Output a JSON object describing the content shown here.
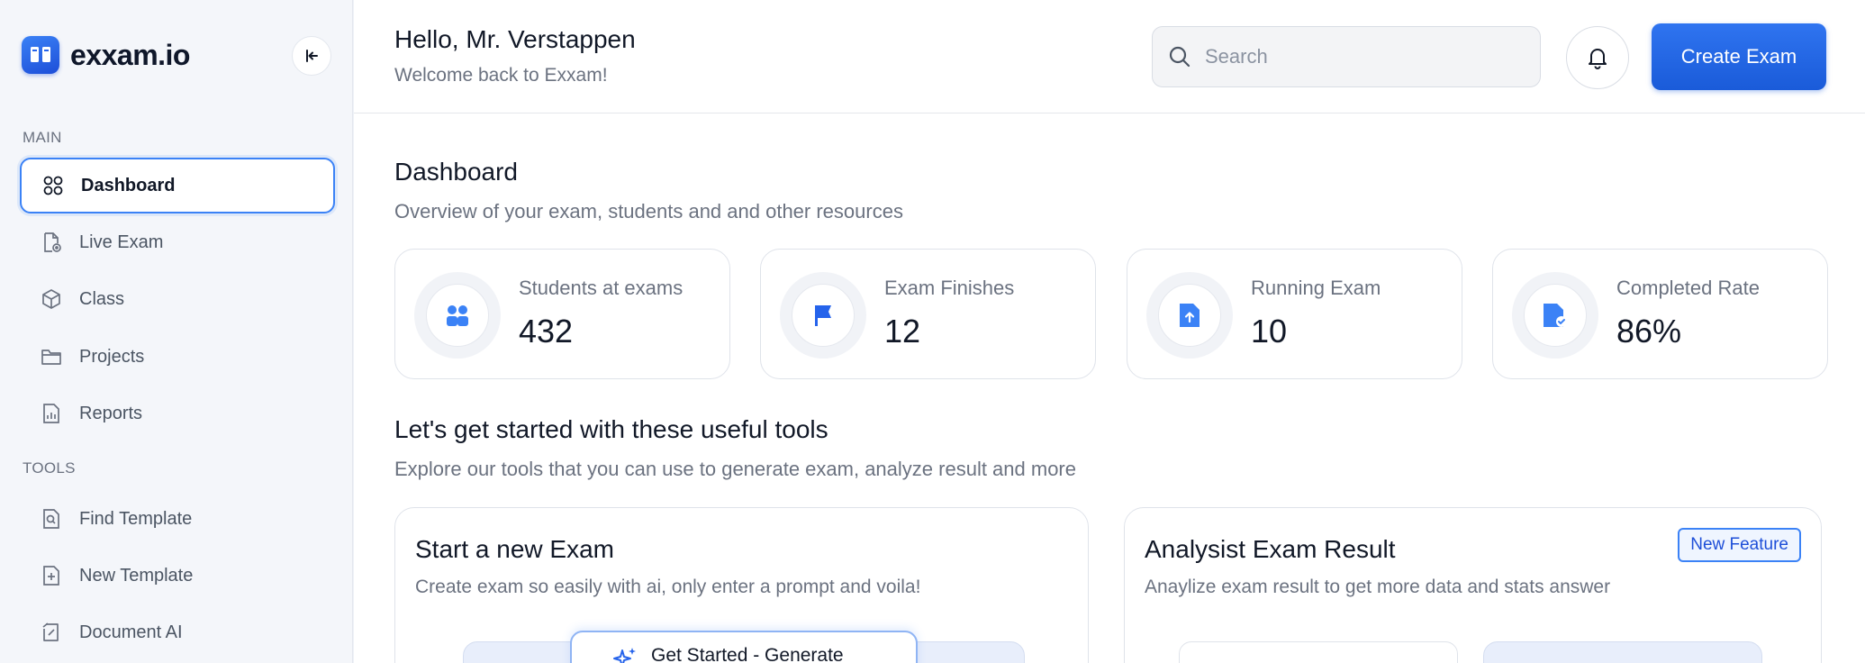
{
  "brand": {
    "name": "exxam.io"
  },
  "sidebar": {
    "sections": [
      {
        "label": "MAIN"
      },
      {
        "label": "TOOLS"
      }
    ],
    "main_items": [
      {
        "label": "Dashboard",
        "icon": "grid-icon",
        "active": true
      },
      {
        "label": "Live Exam",
        "icon": "live-file-icon"
      },
      {
        "label": "Class",
        "icon": "cube-icon"
      },
      {
        "label": "Projects",
        "icon": "folder-icon"
      },
      {
        "label": "Reports",
        "icon": "report-chart-icon"
      }
    ],
    "tool_items": [
      {
        "label": "Find Template",
        "icon": "file-search-icon"
      },
      {
        "label": "New Template",
        "icon": "file-plus-icon"
      },
      {
        "label": "Document AI",
        "icon": "document-ai-icon"
      }
    ]
  },
  "header": {
    "greeting": "Hello, Mr. Verstappen",
    "welcome": "Welcome back to Exxam!",
    "search_placeholder": "Search",
    "create_label": "Create Exam"
  },
  "dashboard": {
    "title": "Dashboard",
    "subtitle": "Overview of your exam, students and and other resources",
    "stats": [
      {
        "label": "Students at exams",
        "value": "432",
        "icon": "users-icon"
      },
      {
        "label": "Exam Finishes",
        "value": "12",
        "icon": "flag-icon"
      },
      {
        "label": "Running Exam",
        "value": "10",
        "icon": "upload-file-icon"
      },
      {
        "label": "Completed Rate",
        "value": "86%",
        "icon": "check-file-icon"
      }
    ]
  },
  "tools": {
    "title": "Let's get started with these useful tools",
    "subtitle": "Explore our tools that you can use to generate exam, analyze result and more",
    "cards": [
      {
        "title": "Start a new Exam",
        "subtitle": "Create exam so easily with ai, only enter a prompt and voila!",
        "preview_label": "Get Started - Generate"
      },
      {
        "title": "Analysist Exam Result",
        "subtitle": "Anaylize exam result to get more data and stats answer",
        "badge": "New Feature"
      }
    ]
  },
  "colors": {
    "accent": "#1a5bd9",
    "active_border": "#3b82f6"
  }
}
